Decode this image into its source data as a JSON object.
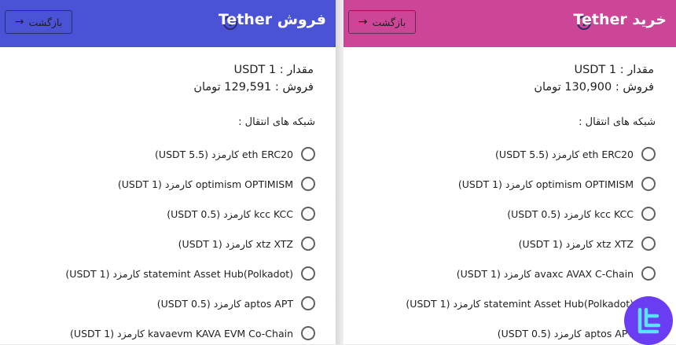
{
  "sell": {
    "title": "فروش Tether",
    "back_label": "بازگشت",
    "amount_line": "مقدار : USDT 1",
    "price_line": "فروش : 129,591 تومان",
    "networks_label": "شبکه های انتقال :",
    "networks": [
      "eth ERC20 کارمزد (USDT 5.5)",
      "optimism OPTIMISM کارمزد (USDT 1)",
      "kcc KCC کارمزد (USDT 0.5)",
      "xtz XTZ کارمزد (USDT 1)",
      "statemint Asset Hub(Polkadot) کارمزد (USDT 1)",
      "aptos APT کارمزد (USDT 0.5)",
      "kavaevm KAVA EVM Co-Chain کارمزد (USDT 1)"
    ]
  },
  "buy": {
    "title": "خرید Tether",
    "back_label": "بازگشت",
    "amount_line": "مقدار : USDT 1",
    "price_line": "فروش : 130,900 تومان",
    "networks_label": "شبکه های انتقال :",
    "networks": [
      "eth ERC20 کارمزد (USDT 5.5)",
      "optimism OPTIMISM کارمزد (USDT 1)",
      "kcc KCC کارمزد (USDT 0.5)",
      "xtz XTZ کارمزد (USDT 1)",
      "avaxc AVAX C-Chain کارمزد (USDT 1)",
      "statemint Asset Hub(Polkadot) کارمزد (USDT 1)",
      "aptos APT کارمزد (USDT 0.5)"
    ]
  },
  "icons": {
    "info": "info-icon",
    "back": "arrow-right-icon",
    "logo": "brand-logo"
  },
  "colors": {
    "sell_header": "#4a52d6",
    "buy_header": "#cd4597",
    "logo_bg": "#6b3df2"
  }
}
